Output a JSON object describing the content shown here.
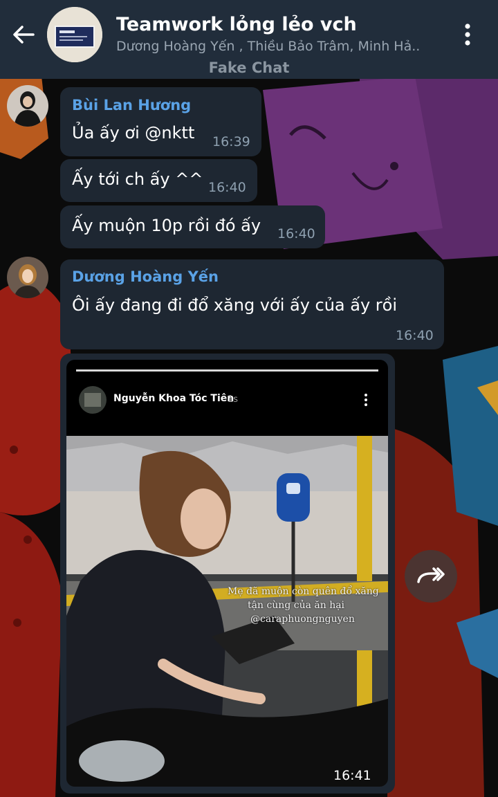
{
  "header": {
    "title": "Teamwork lỏng lẻo vch",
    "members": "Dương Hoàng Yến , Thiều Bảo Trâm, Minh Hả..",
    "subtitle": "Fake Chat"
  },
  "messages": [
    {
      "sender": "Bùi Lan Hương",
      "text": "Ủa ấy ơi @nktt",
      "time": "16:39"
    },
    {
      "text": "Ấy tới ch ấy ^^",
      "time": "16:40"
    },
    {
      "text": "Ấy muộn 10p rồi đó ấy",
      "time": "16:40"
    },
    {
      "sender": "Dương Hoàng Yến",
      "text": "Ôi ấy đang đi đổ xăng với ấy của ấy rồi",
      "time": "16:40"
    }
  ],
  "story": {
    "author": "Nguyễn Khoa Tóc Tiên",
    "age": "1s",
    "caption_line1": "Mẹ đã muộn còn quên đổ xăng",
    "caption_line2": "tận cùng của ăn hại",
    "caption_handle": "@caraphuongnguyen",
    "time": "16:41"
  },
  "icons": {
    "back": "arrow-left-icon",
    "menu": "more-vertical-icon",
    "forward": "forward-icon"
  },
  "colors": {
    "header_bg": "#212d3b",
    "bubble_bg": "#1e2732",
    "sender_name": "#5aa2e6"
  }
}
